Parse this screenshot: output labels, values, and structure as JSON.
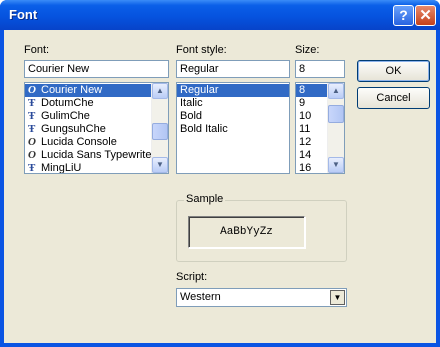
{
  "window": {
    "title": "Font",
    "help_glyph": "?",
    "close_glyph": "✕"
  },
  "font": {
    "label": "Font:",
    "value": "Courier New",
    "items": [
      {
        "label": "Courier New",
        "icon": "opentype-font-icon",
        "selected": true
      },
      {
        "label": "DotumChe",
        "icon": "truetype-font-icon",
        "selected": false
      },
      {
        "label": "GulimChe",
        "icon": "truetype-font-icon",
        "selected": false
      },
      {
        "label": "GungsuhChe",
        "icon": "truetype-font-icon",
        "selected": false
      },
      {
        "label": "Lucida Console",
        "icon": "opentype-font-icon",
        "selected": false
      },
      {
        "label": "Lucida Sans Typewrite",
        "icon": "opentype-font-icon",
        "selected": false
      },
      {
        "label": "MingLiU",
        "icon": "truetype-font-icon",
        "selected": false
      }
    ]
  },
  "style": {
    "label": "Font style:",
    "value": "Regular",
    "items": [
      {
        "label": "Regular",
        "selected": true
      },
      {
        "label": "Italic",
        "selected": false
      },
      {
        "label": "Bold",
        "selected": false
      },
      {
        "label": "Bold Italic",
        "selected": false
      }
    ]
  },
  "size": {
    "label": "Size:",
    "value": "8",
    "items": [
      {
        "label": "8",
        "selected": true
      },
      {
        "label": "9",
        "selected": false
      },
      {
        "label": "10",
        "selected": false
      },
      {
        "label": "11",
        "selected": false
      },
      {
        "label": "12",
        "selected": false
      },
      {
        "label": "14",
        "selected": false
      },
      {
        "label": "16",
        "selected": false
      }
    ]
  },
  "buttons": {
    "ok": "OK",
    "cancel": "Cancel"
  },
  "sample": {
    "label": "Sample",
    "text": "AaBbYyZz"
  },
  "script": {
    "label": "Script:",
    "value": "Western"
  },
  "colors": {
    "title_bar": "#0653df",
    "selection": "#316ac5",
    "dialog_bg": "#ece9d8"
  }
}
